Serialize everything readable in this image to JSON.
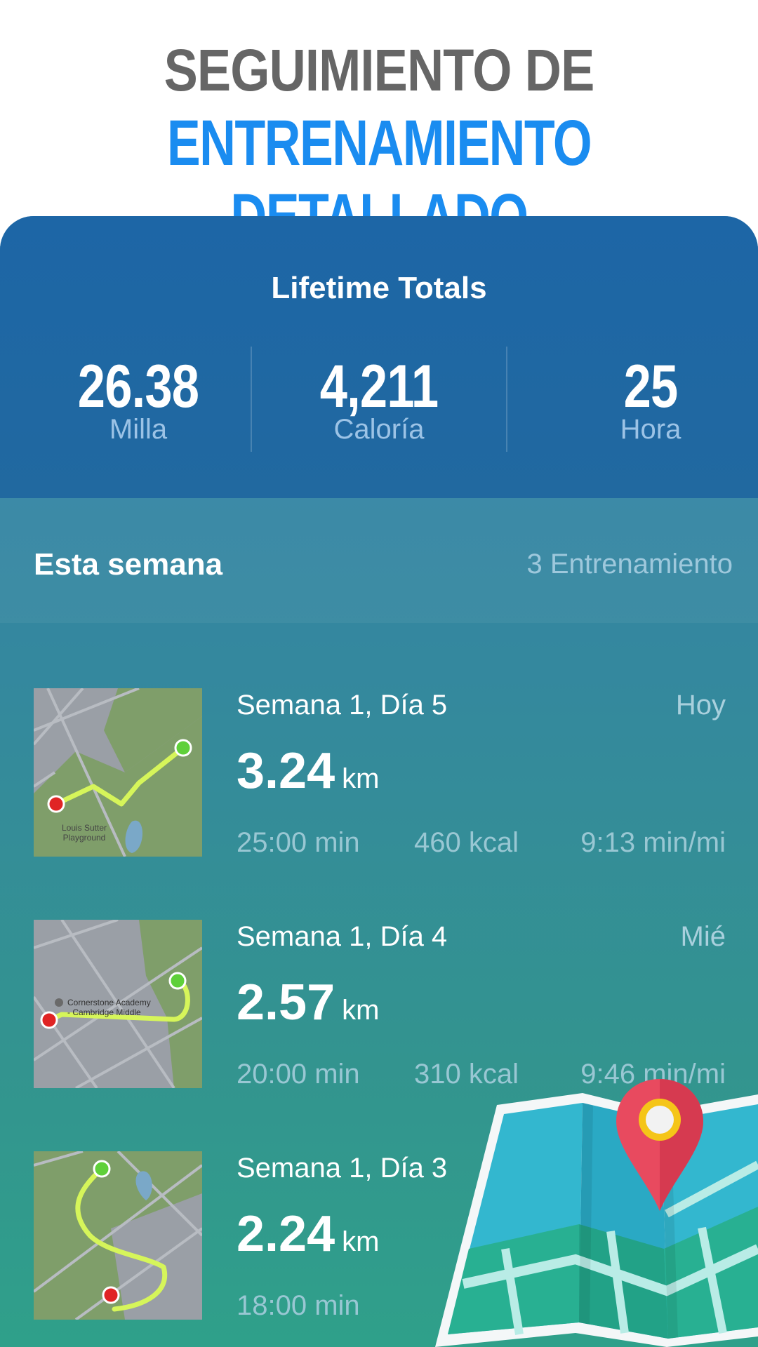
{
  "headline": {
    "line1": "SEGUIMIENTO DE",
    "line2": "ENTRENAMIENTO DETALLADO"
  },
  "totals": {
    "title": "Lifetime Totals",
    "stats": [
      {
        "value": "26.38",
        "label": "Milla"
      },
      {
        "value": "4,211",
        "label": "Caloría"
      },
      {
        "value": "25",
        "label": "Hora"
      }
    ]
  },
  "week": {
    "title": "Esta semana",
    "count": "3 Entrenamiento"
  },
  "workouts": [
    {
      "name": "Semana 1, Día 5",
      "day": "Hoy",
      "distance": "3.24",
      "unit": "km",
      "time": "25:00 min",
      "kcal": "460 kcal",
      "pace": "9:13 min/mi"
    },
    {
      "name": "Semana 1, Día 4",
      "day": "Mié",
      "distance": "2.57",
      "unit": "km",
      "time": "20:00 min",
      "kcal": "310 kcal",
      "pace": "9:46 min/mi"
    },
    {
      "name": "Semana 1, Día 3",
      "day": "",
      "distance": "2.24",
      "unit": "km",
      "time": "18:00 min",
      "kcal": "",
      "pace": ""
    }
  ],
  "map_labels": {
    "w1": [
      "Louis Sutter",
      "Playground"
    ],
    "w2": [
      "Cornerstone Academy",
      "- Cambridge Middle"
    ]
  },
  "colors": {
    "accent_blue": "#1a8cf0",
    "headline_gray": "#666666",
    "route": "#d6f55a",
    "start_dot": "#e02424",
    "end_dot": "#5fd03a"
  }
}
